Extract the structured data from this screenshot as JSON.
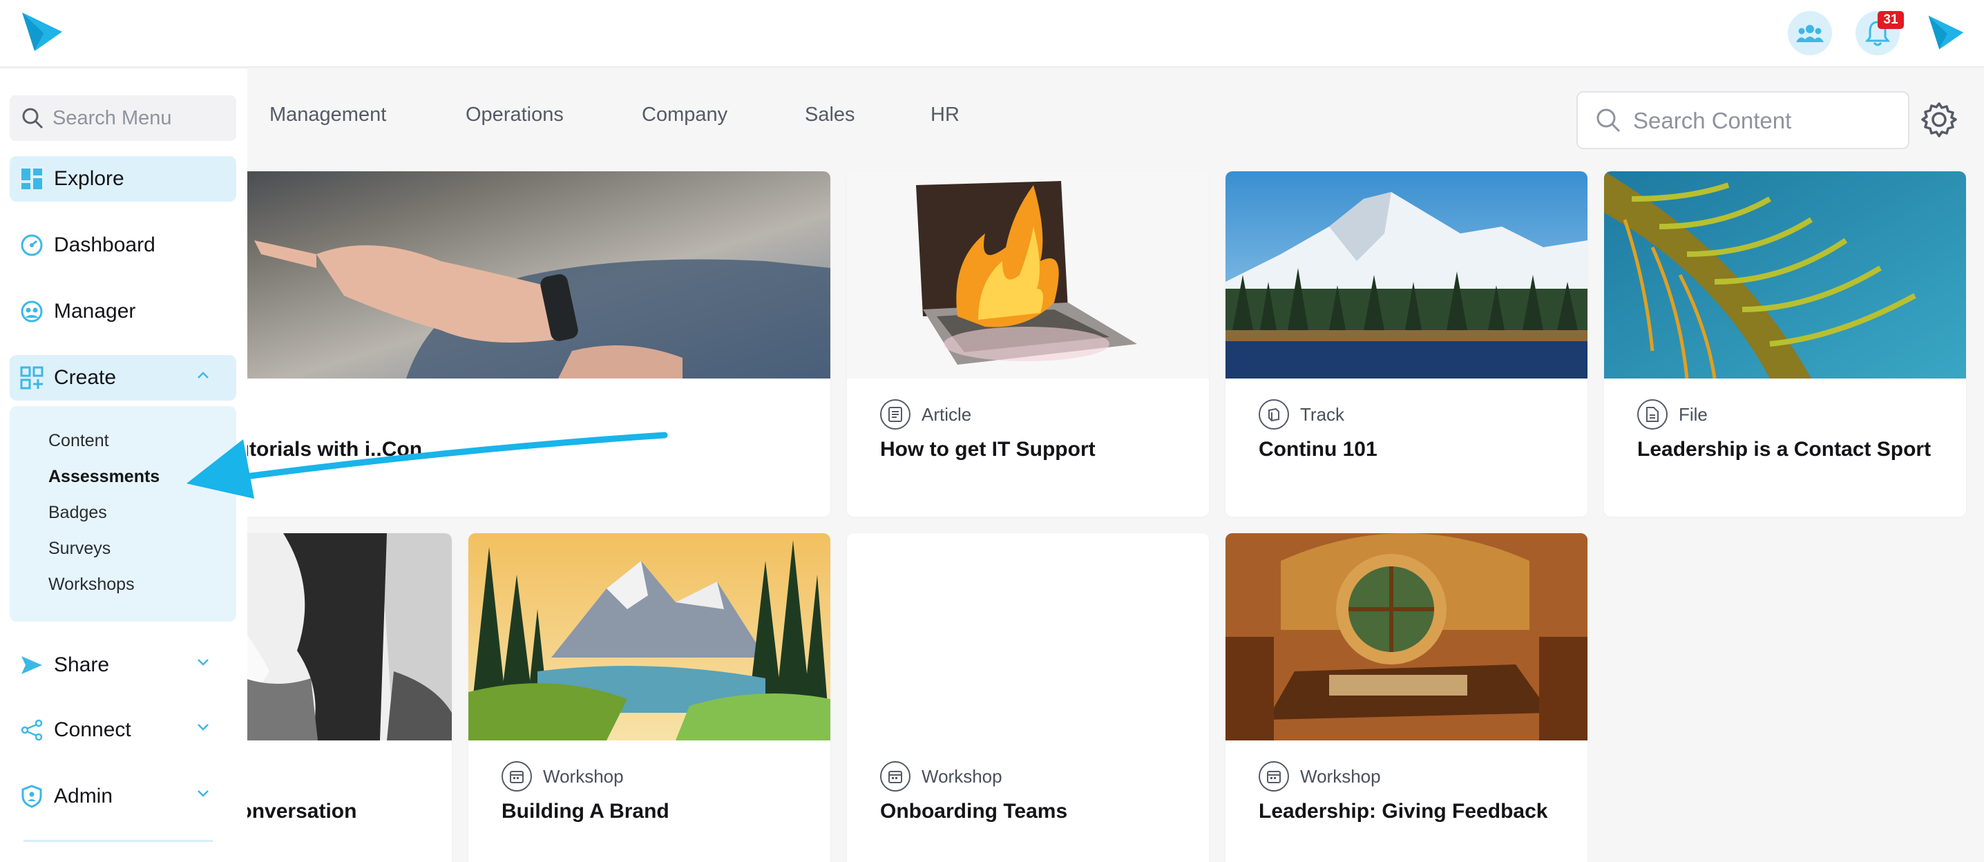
{
  "header": {
    "logo": "continu-logo-icon",
    "notifications_count": "31",
    "icons": [
      "team-icon",
      "bell-icon",
      "continu-logo-icon"
    ]
  },
  "sidebar": {
    "search_placeholder": "Search Menu",
    "items": [
      {
        "label": "Explore",
        "icon": "explore-grid-icon"
      },
      {
        "label": "Dashboard",
        "icon": "dashboard-gauge-icon"
      },
      {
        "label": "Manager",
        "icon": "manager-people-icon"
      },
      {
        "label": "Create",
        "icon": "create-plus-grid-icon"
      },
      {
        "label": "Share",
        "icon": "share-send-icon"
      },
      {
        "label": "Connect",
        "icon": "connect-nodes-icon"
      },
      {
        "label": "Admin",
        "icon": "admin-shield-icon"
      }
    ],
    "create_submenu": [
      "Content",
      "Assessments",
      "Badges",
      "Surveys",
      "Workshops"
    ]
  },
  "tabs": [
    "Management",
    "Operations",
    "Company",
    "Sales",
    "HR"
  ],
  "search_content": {
    "placeholder": "Search Content"
  },
  "cards": [
    {
      "type": "",
      "title": "ctive tutorials with i..Con...",
      "thumb": "hand-pointing-at-screen"
    },
    {
      "type": "Article",
      "title": "How to get IT Support",
      "thumb": "laptop-on-fire"
    },
    {
      "type": "Track",
      "title": "Continu 101",
      "thumb": "snowy-mountain-lake"
    },
    {
      "type": "File",
      "title": "Leadership is a Contact Sport",
      "thumb": "palm-leaf"
    },
    {
      "type": "",
      "title": "ke a Conversation",
      "thumb": "person-in-blazer-bw"
    },
    {
      "type": "Workshop",
      "title": "Building A Brand",
      "thumb": "mountain-lake-painting"
    },
    {
      "type": "Workshop",
      "title": "Onboarding Teams",
      "thumb": "blank"
    },
    {
      "type": "Workshop",
      "title": "Leadership: Giving Feedback",
      "thumb": "hobbit-hole-interior"
    }
  ],
  "colors": {
    "accent": "#1fb3e8",
    "active_bg": "#ddf1fb",
    "submenu_bg": "#e6f5fc",
    "badge": "#e01b24"
  }
}
